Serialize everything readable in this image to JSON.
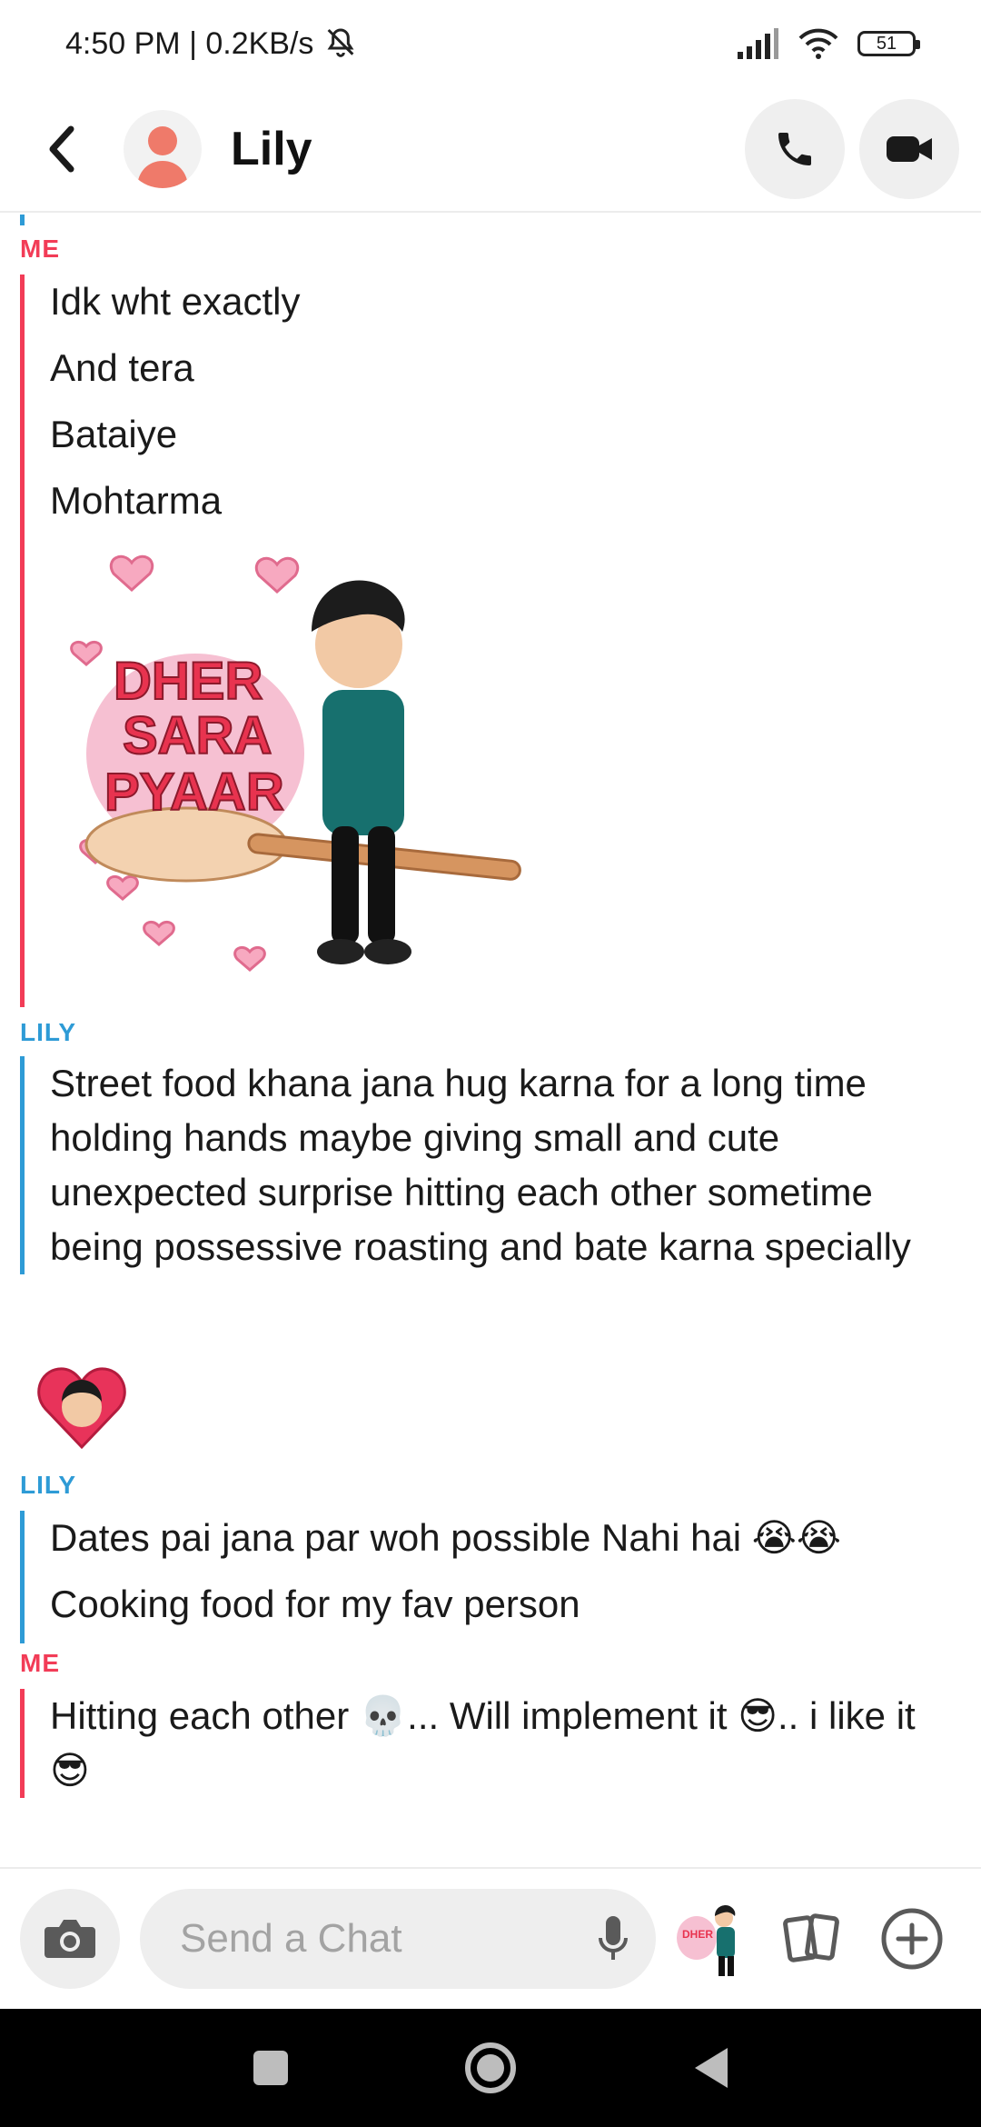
{
  "status_bar": {
    "time_speed": "4:50 PM | 0.2KB/s",
    "battery": "51"
  },
  "header": {
    "contact_name": "Lily"
  },
  "messages": {
    "me_label": "ME",
    "lily_label": "LILY",
    "group1": [
      "Idk wht exactly",
      "And tera",
      "Bataiye",
      "Mohtarma"
    ],
    "sticker_text": "DHER SARA PYAAR",
    "group2": "Street food khana jana hug karna for a long time holding hands maybe giving small and cute unexpected surprise hitting each other sometime being possessive roasting and bate karna specially",
    "group3": [
      "Dates pai jana par woh possible Nahi hai 😭😭",
      "Cooking food for my fav person"
    ],
    "group4": "Hitting each other 💀... Will implement it 😎.. i like it 😎"
  },
  "input_bar": {
    "placeholder": "Send a Chat"
  },
  "colors": {
    "me": "#f23c57",
    "lily": "#2e9bd6"
  },
  "icons": [
    "back-icon",
    "call-icon",
    "video-icon",
    "camera-icon",
    "mic-icon",
    "cards-icon",
    "plus-icon",
    "recents-icon",
    "home-icon",
    "nav-back-icon"
  ]
}
